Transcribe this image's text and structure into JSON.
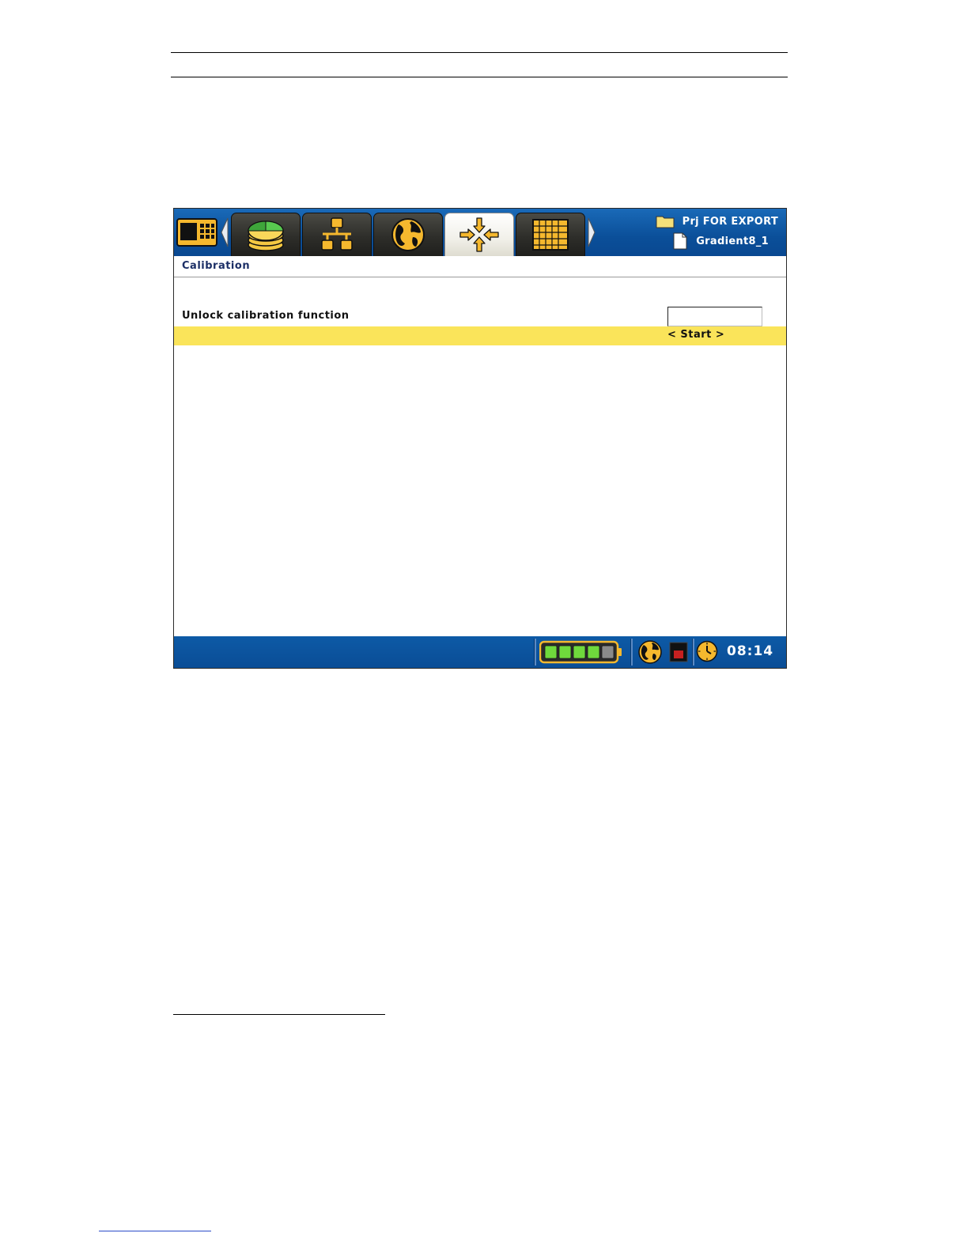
{
  "project": {
    "folder_name": "Prj FOR EXPORT",
    "file_name": "Gradient8_1"
  },
  "tabs": [
    {
      "icon": "database-pie-icon",
      "active": false
    },
    {
      "icon": "network-icon",
      "active": false
    },
    {
      "icon": "globe-icon",
      "active": false
    },
    {
      "icon": "calibration-arrows-icon",
      "active": true
    },
    {
      "icon": "grid-icon",
      "active": false
    }
  ],
  "section": {
    "title": "Calibration"
  },
  "settings": {
    "unlock_label": "Unlock calibration function",
    "unlock_value": "",
    "start_label": "< Start >"
  },
  "status": {
    "battery_segments_filled": 4,
    "battery_segments_total": 5,
    "time": "08:14"
  },
  "colors": {
    "topbar": "#0b4f99",
    "highlight_row": "#fae45a",
    "section_title": "#1c2f66",
    "icon_accent": "#f5b82e"
  }
}
